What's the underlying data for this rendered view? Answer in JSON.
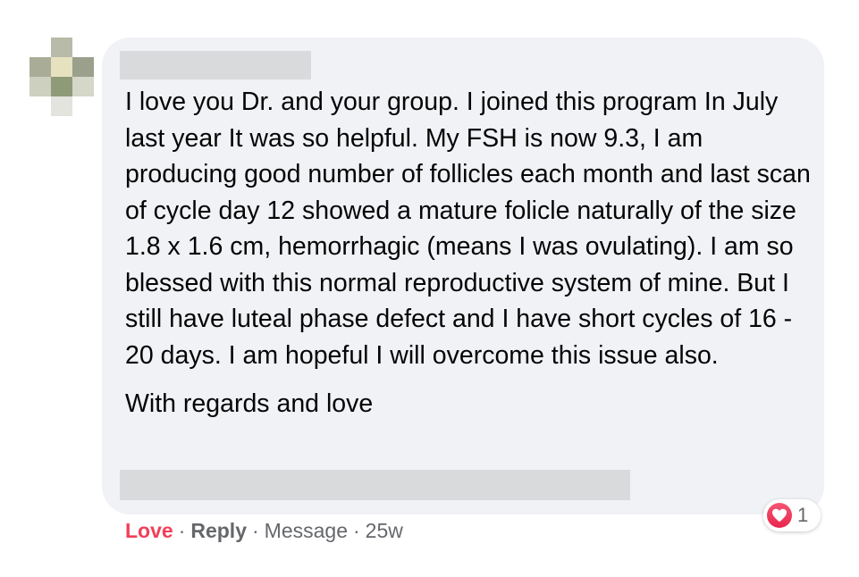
{
  "comment": {
    "author_name": "",
    "paragraphs": [
      "I love you Dr. and your group. I joined this program In July last year It was so helpful. My FSH is now 9.3, I am producing good number of follicles each month and last scan of cycle day 12 showed a mature folicle naturally of the size 1.8 x 1.6 cm, hemorrhagic (means I was ovulating). I am so blessed with this normal reproductive system of mine. But I still have luteal phase defect and I have short cycles of 16 - 20 days. I am hopeful I will overcome this issue also.",
      "With regards and love"
    ]
  },
  "reactions": {
    "icon": "love-heart-icon",
    "count": "1",
    "color": "#f33e58"
  },
  "actions": {
    "love_label": "Love",
    "reply_label": "Reply",
    "message_label": "Message",
    "separator": "·",
    "timestamp": "25w"
  },
  "colors": {
    "bubble_bg": "#f0f2f5",
    "action_text": "#65676b",
    "love_red": "#f33e58",
    "blur_gray": "#d9dadc"
  }
}
